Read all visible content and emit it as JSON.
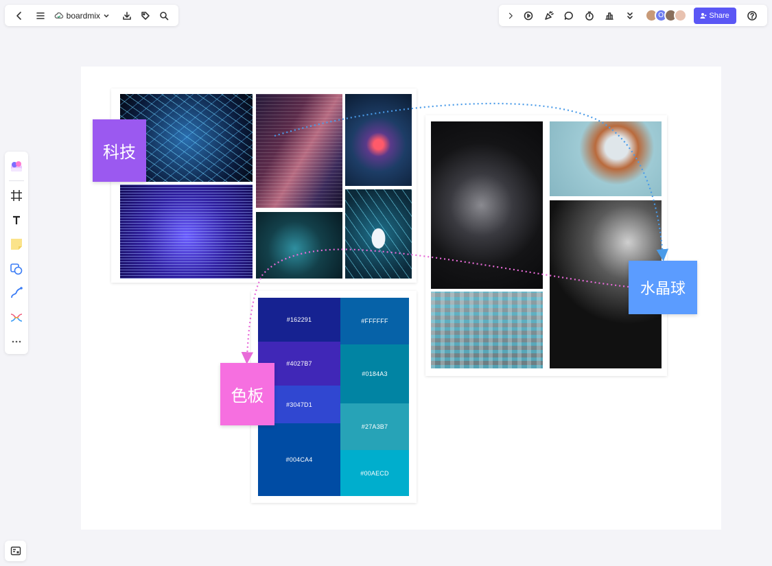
{
  "app": {
    "name": "boardmix"
  },
  "topbar_right": {
    "share_label": "Share",
    "avatar_initial": "O"
  },
  "stickies": {
    "tech": "科技",
    "crystal": "水晶球",
    "palette": "色板"
  },
  "palette": {
    "left": [
      {
        "hex": "#162291",
        "label": "#162291"
      },
      {
        "hex": "#4027B7",
        "label": "#4027B7"
      },
      {
        "hex": "#3047D1",
        "label": "#3047D1"
      },
      {
        "hex": "#004CA4",
        "label": "#004CA4"
      }
    ],
    "right": [
      {
        "hex": "#0662A8",
        "label": "#FFFFFF"
      },
      {
        "hex": "#0184A3",
        "label": "#0184A3"
      },
      {
        "hex": "#27A3B7",
        "label": "#27A3B7"
      },
      {
        "hex": "#00AECD",
        "label": "#00AECD"
      }
    ]
  },
  "colors": {
    "tech_sticky": "#9b59f0",
    "crystal_sticky": "#5b9cff",
    "palette_sticky": "#f66fe0",
    "share_button": "#5b57f5",
    "connector_blue": "#4a9be8",
    "connector_pink": "#e86bd8"
  },
  "icons": {
    "topbar_left": [
      "back-icon",
      "menu-icon",
      "cloud-icon",
      "download-icon",
      "tag-icon",
      "search-icon"
    ],
    "topbar_right": [
      "expand-icon",
      "play-icon",
      "celebrate-icon",
      "comment-icon",
      "timer-icon",
      "vote-icon",
      "more-down-icon",
      "help-icon"
    ],
    "side": [
      "templates-icon",
      "frame-icon",
      "text-icon",
      "sticky-note-icon",
      "shape-icon",
      "pen-icon",
      "mindmap-icon",
      "more-icon"
    ],
    "bottom": [
      "minimap-icon"
    ]
  }
}
